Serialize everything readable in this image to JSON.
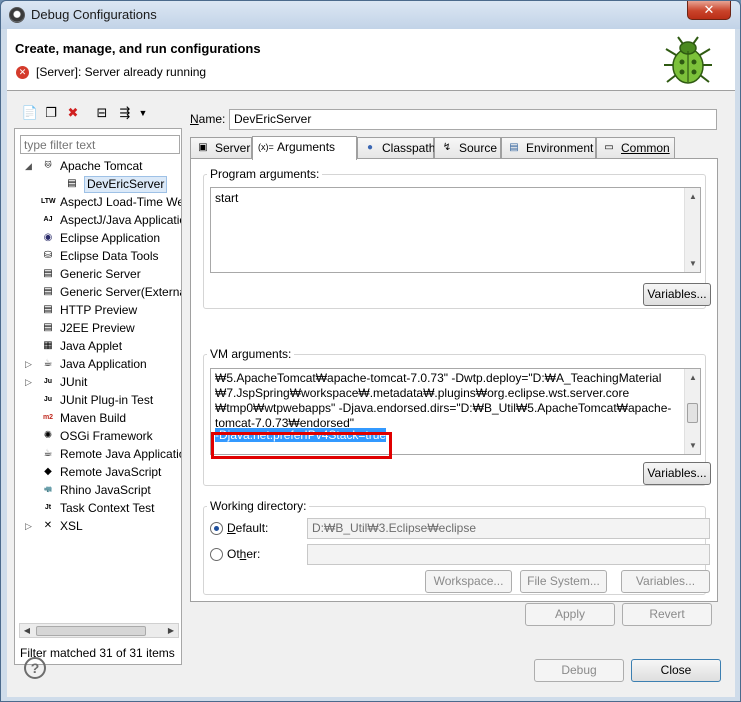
{
  "window": {
    "title": "Debug Configurations"
  },
  "header": {
    "title": "Create, manage, and run configurations",
    "message": "[Server]: Server already running"
  },
  "left": {
    "filter_placeholder": "type filter text",
    "tree": [
      {
        "label": "Apache Tomcat",
        "icon": "tomcat-icon",
        "expanded": true,
        "level": 0
      },
      {
        "label": "DevEricServer",
        "icon": "server-config-icon",
        "level": 1,
        "selected": true
      },
      {
        "label": "AspectJ Load-Time Weaving",
        "icon": "ltw-icon",
        "level": 0
      },
      {
        "label": "AspectJ/Java Application",
        "icon": "aj-icon",
        "level": 0
      },
      {
        "label": "Eclipse Application",
        "icon": "eclipse-icon",
        "level": 0
      },
      {
        "label": "Eclipse Data Tools",
        "icon": "database-icon",
        "level": 0
      },
      {
        "label": "Generic Server",
        "icon": "server-icon",
        "level": 0
      },
      {
        "label": "Generic Server(External",
        "icon": "server-icon",
        "level": 0
      },
      {
        "label": "HTTP Preview",
        "icon": "server-icon",
        "level": 0
      },
      {
        "label": "J2EE Preview",
        "icon": "server-icon",
        "level": 0
      },
      {
        "label": "Java Applet",
        "icon": "applet-icon",
        "level": 0
      },
      {
        "label": "Java Application",
        "icon": "java-app-icon",
        "level": 0,
        "collapsed": true
      },
      {
        "label": "JUnit",
        "icon": "junit-icon",
        "level": 0,
        "collapsed": true
      },
      {
        "label": "JUnit Plug-in Test",
        "icon": "junit-plugin-icon",
        "level": 0
      },
      {
        "label": "Maven Build",
        "icon": "maven-icon",
        "level": 0
      },
      {
        "label": "OSGi Framework",
        "icon": "osgi-icon",
        "level": 0
      },
      {
        "label": "Remote Java Application",
        "icon": "remote-java-icon",
        "level": 0
      },
      {
        "label": "Remote JavaScript",
        "icon": "remote-js-icon",
        "level": 0
      },
      {
        "label": "Rhino JavaScript",
        "icon": "rhino-icon",
        "level": 0
      },
      {
        "label": "Task Context Test",
        "icon": "task-context-icon",
        "level": 0
      },
      {
        "label": "XSL",
        "icon": "xsl-icon",
        "level": 0,
        "collapsed": true
      }
    ],
    "filter_status": "Filter matched 31 of 31 items"
  },
  "right": {
    "name_label": "Name:",
    "name_value": "DevEricServer",
    "tabs": [
      {
        "label": "Server",
        "icon": "server-tab-icon"
      },
      {
        "label": "Arguments",
        "icon": "arguments-tab-icon",
        "active": true
      },
      {
        "label": "Classpath",
        "icon": "classpath-tab-icon"
      },
      {
        "label": "Source",
        "icon": "source-tab-icon"
      },
      {
        "label": "Environment",
        "icon": "environment-tab-icon"
      },
      {
        "label": "Common",
        "icon": "common-tab-icon"
      }
    ],
    "program_args": {
      "legend": "Program arguments:",
      "value": "start",
      "variables_btn": "Variables..."
    },
    "vm_args": {
      "legend": "VM arguments:",
      "lines": [
        "₩5.ApacheTomcat₩apache-tomcat-7.0.73\" -Dwtp.deploy=\"D:₩A_TeachingMaterial",
        "₩7.JspSpring₩workspace₩.metadata₩.plugins₩org.eclipse.wst.server.core",
        "₩tmp0₩wtpwebapps\" -Djava.endorsed.dirs=\"D:₩B_Util₩5.ApacheTomcat₩apache-",
        "tomcat-7.0.73₩endorsed\""
      ],
      "selected_line": "-Djava.net.preferIPv4Stack=true",
      "variables_btn": "Variables..."
    },
    "working_dir": {
      "legend": "Working directory:",
      "default_label": "Default:",
      "default_value": "D:₩B_Util₩3.Eclipse₩eclipse",
      "other_label": "Other:",
      "other_value": "",
      "workspace_btn": "Workspace...",
      "filesystem_btn": "File System...",
      "variables_btn": "Variables..."
    },
    "apply_btn": "Apply",
    "revert_btn": "Revert"
  },
  "footer": {
    "debug_btn": "Debug",
    "close_btn": "Close"
  },
  "colors": {
    "selection": "#3399ff",
    "highlight_box": "#e00000",
    "error": "#d43b2c"
  }
}
